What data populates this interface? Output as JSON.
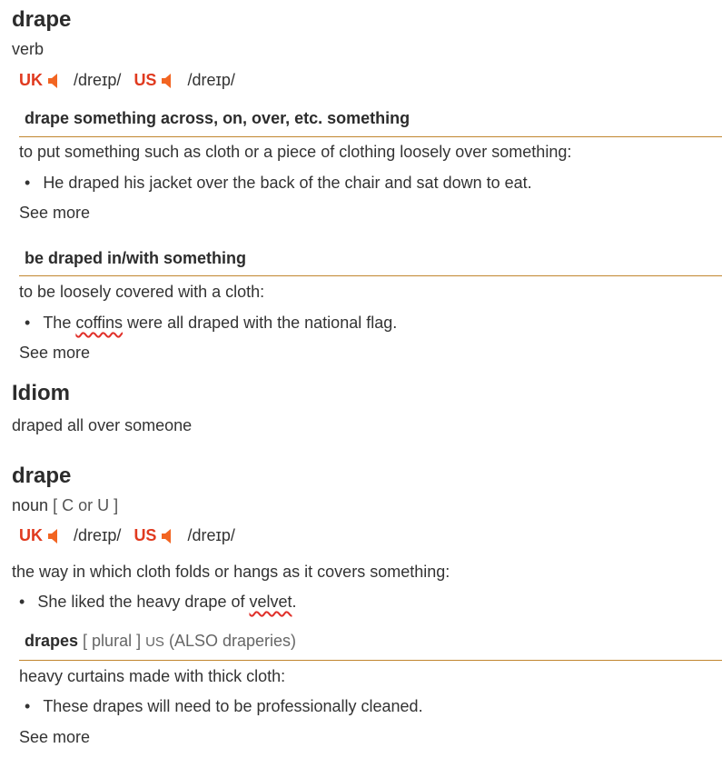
{
  "entry1": {
    "headword": "drape",
    "pos": "verb",
    "uk_label": "UK",
    "uk_ipa": "/dreɪp/",
    "us_label": "US",
    "us_ipa": "/dreɪp/",
    "sense1": {
      "phrase": "drape something across, on, over, etc. something",
      "definition": "to put something such as cloth or a piece of clothing loosely over something:",
      "example": "He draped his jacket over the back of the chair and sat down to eat.",
      "see_more": "See more"
    },
    "sense2": {
      "phrase": "be draped in/with something",
      "definition": "to be loosely covered with a cloth:",
      "example_pre": "The ",
      "example_word": "coffins",
      "example_post": " were all draped with the national flag.",
      "see_more": "See more"
    }
  },
  "idiom": {
    "heading": "Idiom",
    "item": "draped all over someone"
  },
  "entry2": {
    "headword": "drape",
    "pos": "noun",
    "grammar": "[ C or U ]",
    "uk_label": "UK",
    "uk_ipa": "/dreɪp/",
    "us_label": "US",
    "us_ipa": "/dreɪp/",
    "definition": "the way in which cloth folds or hangs as it covers something:",
    "example_pre": "She liked the heavy drape of ",
    "example_word": "velvet",
    "example_post": ".",
    "sub": {
      "word": "drapes",
      "grammar": "[ plural ]",
      "region": "US",
      "also": "(ALSO draperies)",
      "definition": "heavy curtains made with thick cloth:",
      "example": "These drapes will need to be professionally cleaned.",
      "see_more": "See more"
    }
  },
  "colors": {
    "region": "#e03a1f",
    "speaker": "#f26522",
    "rule": "#c1862f",
    "squiggle": "#e0302a"
  },
  "icons": {
    "speaker": "speaker-icon"
  }
}
